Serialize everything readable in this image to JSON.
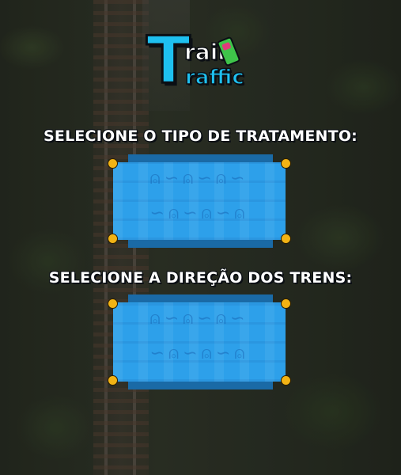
{
  "logo": {
    "letter_t": "T",
    "word_rain": "rain",
    "word_raffic": "raffic",
    "primary_color": "#1ec0f0",
    "accent_colors": [
      "#3fc44a",
      "#e13a7a"
    ]
  },
  "sections": {
    "treatment": {
      "heading": "SELECIONE O TIPO DE TRATAMENTO:"
    },
    "direction": {
      "heading": "SELECIONE A DIREÇÃO DOS TRENS:"
    }
  },
  "panel_style": {
    "face_color": "#2da0ea",
    "shadow_color": "#1a6aa6",
    "corner_color": "#f2b315"
  }
}
